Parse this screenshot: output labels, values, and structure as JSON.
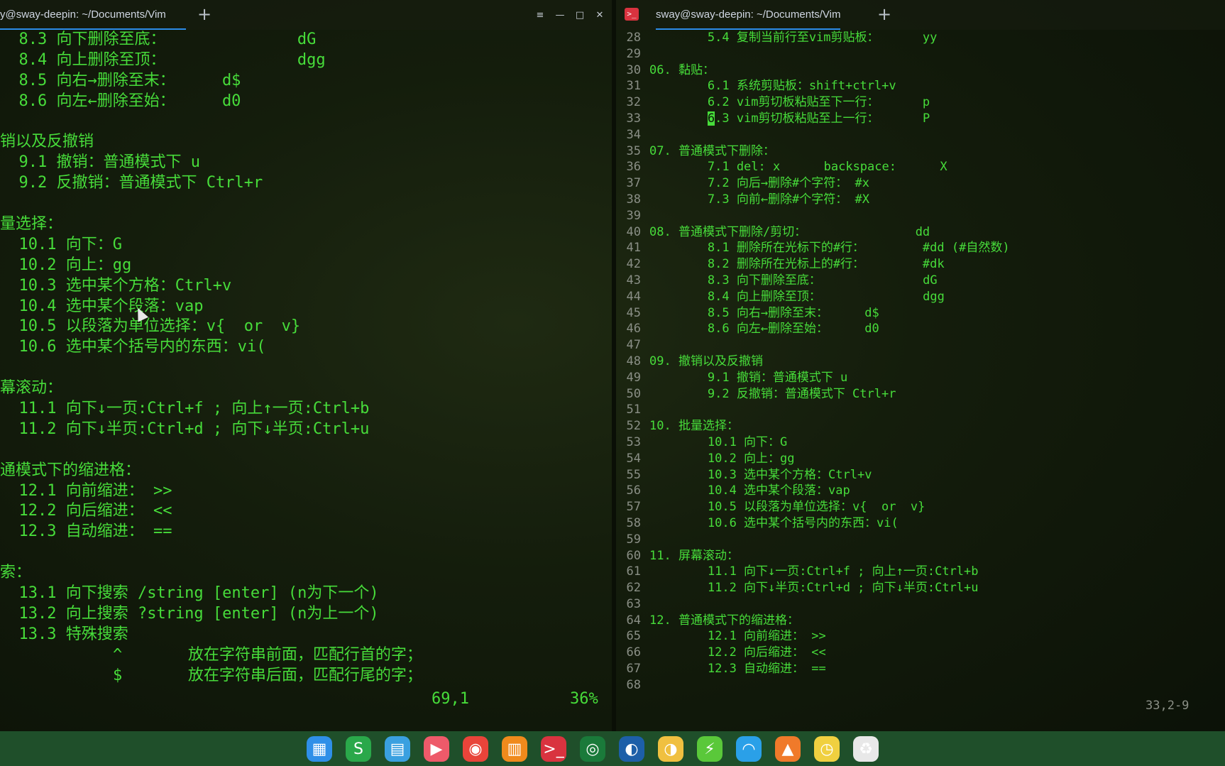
{
  "left_terminal": {
    "tab_title": "y@sway-deepin: ~/Documents/Vim",
    "new_tab_label": "+",
    "window_buttons": [
      "≡",
      "—",
      "□",
      "✕"
    ],
    "lines": [
      "  8.3 向下删除至底：              dG",
      "  8.4 向上删除至顶：              dgg",
      "  8.5 向右→删除至末：     d$",
      "  8.6 向左←删除至始：     d0",
      "",
      "销以及反撤销",
      "  9.1 撤销：普通模式下 u",
      "  9.2 反撤销：普通模式下 Ctrl+r",
      "",
      "量选择：",
      "  10.1 向下：G",
      "  10.2 向上：gg",
      "  10.3 选中某个方格：Ctrl+v",
      "  10.4 选中某个段落：vap",
      "  10.5 以段落为单位选择：v{  or  v}",
      "  10.6 选中某个括号内的东西：vi(",
      "",
      "幕滚动：",
      "  11.1 向下↓一页:Ctrl+f ; 向上↑一页:Ctrl+b",
      "  11.2 向下↓半页:Ctrl+d ; 向下↓半页:Ctrl+u",
      "",
      "通模式下的缩进格：",
      "  12.1 向前缩进： >>",
      "  12.2 向后缩进： <<",
      "  12.3 自动缩进： ==",
      "",
      "索：",
      "  13.1 向下搜索 /string [enter] (n为下一个)",
      "  13.2 向上搜索 ?string [enter] (n为上一个)",
      "  13.3 特殊搜索",
      "            ^       放在字符串前面，匹配行首的字；",
      "            $       放在字符串后面，匹配行尾的字；"
    ],
    "status_position": "69,1",
    "status_percent": "36%"
  },
  "right_terminal": {
    "tab_title": "sway@sway-deepin: ~/Documents/Vim",
    "new_tab_label": "+",
    "terminal_icon": ">_",
    "lines": [
      {
        "num": "28",
        "text": "        5.4 复制当前行至vim剪贴板：      yy"
      },
      {
        "num": "29",
        "text": ""
      },
      {
        "num": "30",
        "text": "06. 黏贴："
      },
      {
        "num": "31",
        "text": "        6.1 系统剪贴板：shift+ctrl+v"
      },
      {
        "num": "32",
        "text": "        6.2 vim剪切板粘贴至下一行：      p"
      },
      {
        "num": "33",
        "text": ".3 vim剪切板粘贴至上一行：      P",
        "cursor_char": "6",
        "indent": "        "
      },
      {
        "num": "34",
        "text": ""
      },
      {
        "num": "35",
        "text": "07. 普通模式下删除："
      },
      {
        "num": "36",
        "text": "        7.1 del: x      backspace:      X"
      },
      {
        "num": "37",
        "text": "        7.2 向后→删除#个字符： #x"
      },
      {
        "num": "38",
        "text": "        7.3 向前←删除#个字符： #X"
      },
      {
        "num": "39",
        "text": ""
      },
      {
        "num": "40",
        "text": "08. 普通模式下删除/剪切：               dd"
      },
      {
        "num": "41",
        "text": "        8.1 删除所在光标下的#行：        #dd (#自然数)"
      },
      {
        "num": "42",
        "text": "        8.2 删除所在光标上的#行：        #dk"
      },
      {
        "num": "43",
        "text": "        8.3 向下删除至底：              dG"
      },
      {
        "num": "44",
        "text": "        8.4 向上删除至顶：              dgg"
      },
      {
        "num": "45",
        "text": "        8.5 向右→删除至末：     d$"
      },
      {
        "num": "46",
        "text": "        8.6 向左←删除至始：     d0"
      },
      {
        "num": "47",
        "text": ""
      },
      {
        "num": "48",
        "text": "09. 撤销以及反撤销"
      },
      {
        "num": "49",
        "text": "        9.1 撤销：普通模式下 u"
      },
      {
        "num": "50",
        "text": "        9.2 反撤销：普通模式下 Ctrl+r"
      },
      {
        "num": "51",
        "text": ""
      },
      {
        "num": "52",
        "text": "10. 批量选择："
      },
      {
        "num": "53",
        "text": "        10.1 向下：G"
      },
      {
        "num": "54",
        "text": "        10.2 向上：gg"
      },
      {
        "num": "55",
        "text": "        10.3 选中某个方格：Ctrl+v"
      },
      {
        "num": "56",
        "text": "        10.4 选中某个段落：vap"
      },
      {
        "num": "57",
        "text": "        10.5 以段落为单位选择：v{  or  v}"
      },
      {
        "num": "58",
        "text": "        10.6 选中某个括号内的东西：vi("
      },
      {
        "num": "59",
        "text": ""
      },
      {
        "num": "60",
        "text": "11. 屏幕滚动："
      },
      {
        "num": "61",
        "text": "        11.1 向下↓一页:Ctrl+f ; 向上↑一页:Ctrl+b"
      },
      {
        "num": "62",
        "text": "        11.2 向下↓半页:Ctrl+d ; 向下↓半页:Ctrl+u"
      },
      {
        "num": "63",
        "text": ""
      },
      {
        "num": "64",
        "text": "12. 普通模式下的缩进格："
      },
      {
        "num": "65",
        "text": "        12.1 向前缩进： >>"
      },
      {
        "num": "66",
        "text": "        12.2 向后缩进： <<"
      },
      {
        "num": "67",
        "text": "        12.3 自动缩进： =="
      },
      {
        "num": "68",
        "text": ""
      }
    ],
    "status_position": "33,2-9"
  },
  "taskbar": {
    "icons": [
      {
        "name": "launcher-icon",
        "glyph": "▦",
        "color": "#2f8fe8"
      },
      {
        "name": "wps-icon",
        "glyph": "S",
        "color": "#2aa84a"
      },
      {
        "name": "file-manager-icon",
        "glyph": "▤",
        "color": "#3aa0e0"
      },
      {
        "name": "screen-recorder-icon",
        "glyph": "▶",
        "color": "#ee5a6a"
      },
      {
        "name": "chrome-icon",
        "glyph": "◉",
        "color": "#e8443a"
      },
      {
        "name": "app-store-icon",
        "glyph": "▥",
        "color": "#f08a1c"
      },
      {
        "name": "terminal-icon",
        "glyph": ">_",
        "color": "#d9333f"
      },
      {
        "name": "camera-icon",
        "glyph": "◎",
        "color": "#1a7a3a"
      },
      {
        "name": "screenshot-icon",
        "glyph": "◐",
        "color": "#1d5fa8"
      },
      {
        "name": "notification-icon",
        "glyph": "◑",
        "color": "#f0c040"
      },
      {
        "name": "power-icon",
        "glyph": "⚡",
        "color": "#5ac83a"
      },
      {
        "name": "wifi-icon",
        "glyph": "◠",
        "color": "#2aa0e8"
      },
      {
        "name": "eject-icon",
        "glyph": "▲",
        "color": "#f07a2a"
      },
      {
        "name": "clock-icon",
        "glyph": "◷",
        "color": "#f0d040"
      },
      {
        "name": "trash-icon",
        "glyph": "♻",
        "color": "#e8e8e8"
      }
    ]
  }
}
